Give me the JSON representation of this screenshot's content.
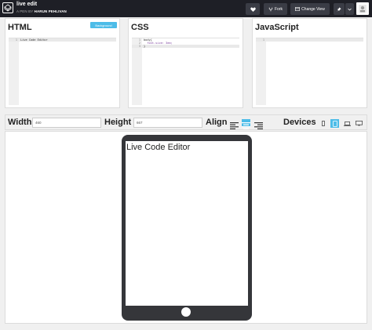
{
  "app": {
    "title": "live edit",
    "byline_prefix": "A PEN BY",
    "author": "HARUN PEHLIVAN"
  },
  "topbar": {
    "fork_label": "Fork",
    "change_view_label": "Change View"
  },
  "panels": {
    "html": {
      "title": "HTML",
      "background_button": "Background",
      "lines": [
        {
          "num": "1",
          "text": "Live Code Editor"
        }
      ]
    },
    "css": {
      "title": "CSS",
      "lines": [
        {
          "num": "1",
          "text": "body{"
        },
        {
          "num": "2",
          "text": "  font-size: 3em;"
        },
        {
          "num": "3",
          "text": "}"
        }
      ]
    },
    "js": {
      "title": "JavaScript",
      "lines": [
        {
          "num": "1",
          "text": ""
        }
      ]
    }
  },
  "toolbar": {
    "width_label": "Width",
    "width_value": "460",
    "height_label": "Height",
    "height_value": "667",
    "align_label": "Align",
    "devices_label": "Devices"
  },
  "preview": {
    "text": "Live Code Editor"
  },
  "colors": {
    "accent": "#4dbce8",
    "topbar_bg": "#1e1f26",
    "device_frame": "#35363a"
  }
}
